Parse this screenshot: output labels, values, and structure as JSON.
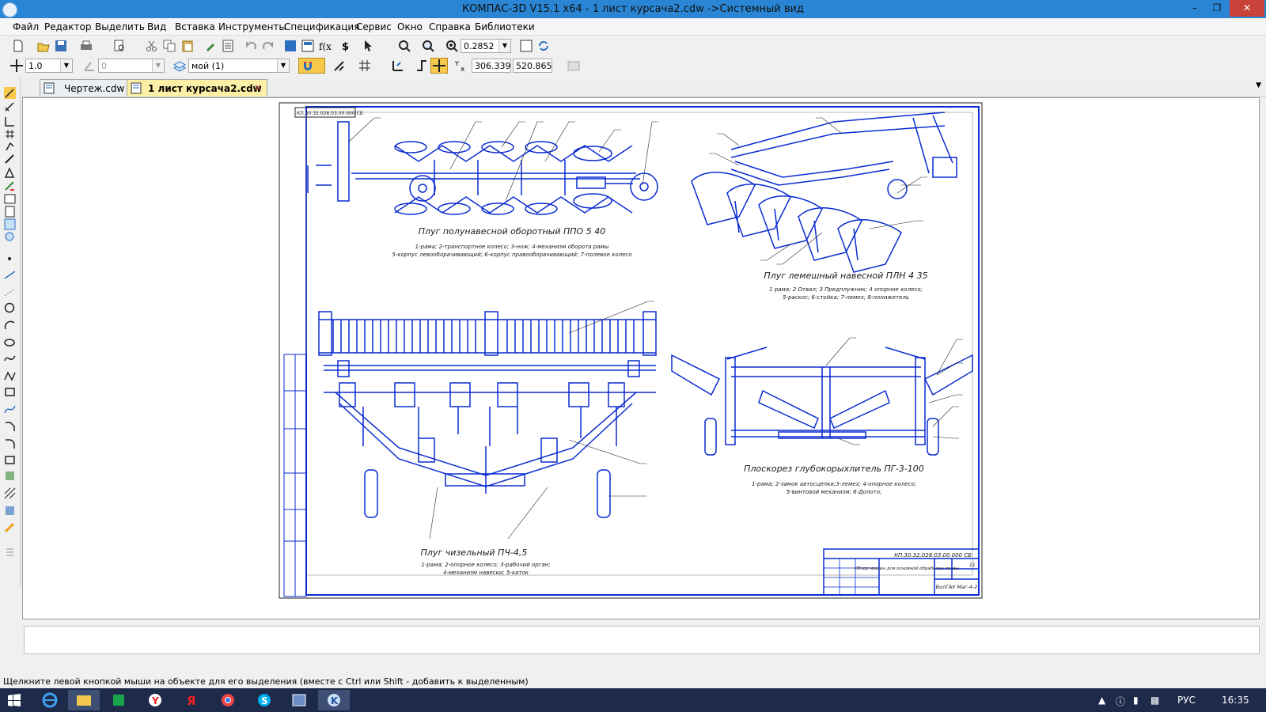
{
  "window": {
    "title": "КОМПАС-3D V15.1 x64 - 1 лист курсача2.cdw ->Системный вид"
  },
  "menu": [
    "Файл",
    "Редактор",
    "Выделить",
    "Вид",
    "Вставка",
    "Инструменты",
    "Спецификация",
    "Сервис",
    "Окно",
    "Справка",
    "Библиотеки"
  ],
  "toolbar": {
    "zoom_value": "0.2852",
    "line_step": "1.0",
    "angle": "0",
    "layer": "мой (1)",
    "coord_x": "306.339",
    "coord_y": "520.865"
  },
  "tabs": [
    {
      "label": "Чертеж.cdw"
    },
    {
      "label": "1 лист курсача2.cdw"
    }
  ],
  "drawing": {
    "stamp_top": "КП.30.32.028.03.00.000 СБ",
    "figures": [
      {
        "title": "Плуг полунавесной оборотный ППО 5 40",
        "legend1": "1-рама; 2-транспортное колесо; 3-нож; 4-механизм оборота рамы",
        "legend2": "5-корпус левооборачивающий; 6-корпус правооборачивающий; 7-полевое колесо"
      },
      {
        "title": "Плуг лемешный навесной ПЛН 4 35",
        "legend1": "1 рама; 2 Отвал; 3 Предплужник; 4 опорное колесо;",
        "legend2": "5-раскос; 6-стойка; 7-лемех; 8-пониже­тель"
      },
      {
        "title": "Плуг чизельный ПЧ-4,5",
        "legend1": "1-рама; 2-опорное колесо; 3-рабочий орган;",
        "legend2": "4-механизм навески; 5-каток"
      },
      {
        "title": "Плоскорез глубокорыхлитель ПГ-3-100",
        "legend1": "1-рама; 2-замок автосцепки;3-лемех; 4-опорное колесо;",
        "legend2": "5-винтовой механизм; 6-Долото;"
      }
    ],
    "stamp": {
      "code": "КП.30.32.028.03.00.000 СБ",
      "name": "Обзор машин для основной обработки почвы",
      "org": "ВолГАУ Маг-4-2",
      "sheet": "11"
    }
  },
  "status_text": "Щелкните левой кнопкой мыши на объекте для его выделения (вместе с Ctrl или Shift - добавить к выделенным)",
  "tray": {
    "lang": "РУС",
    "time": "16:35"
  }
}
